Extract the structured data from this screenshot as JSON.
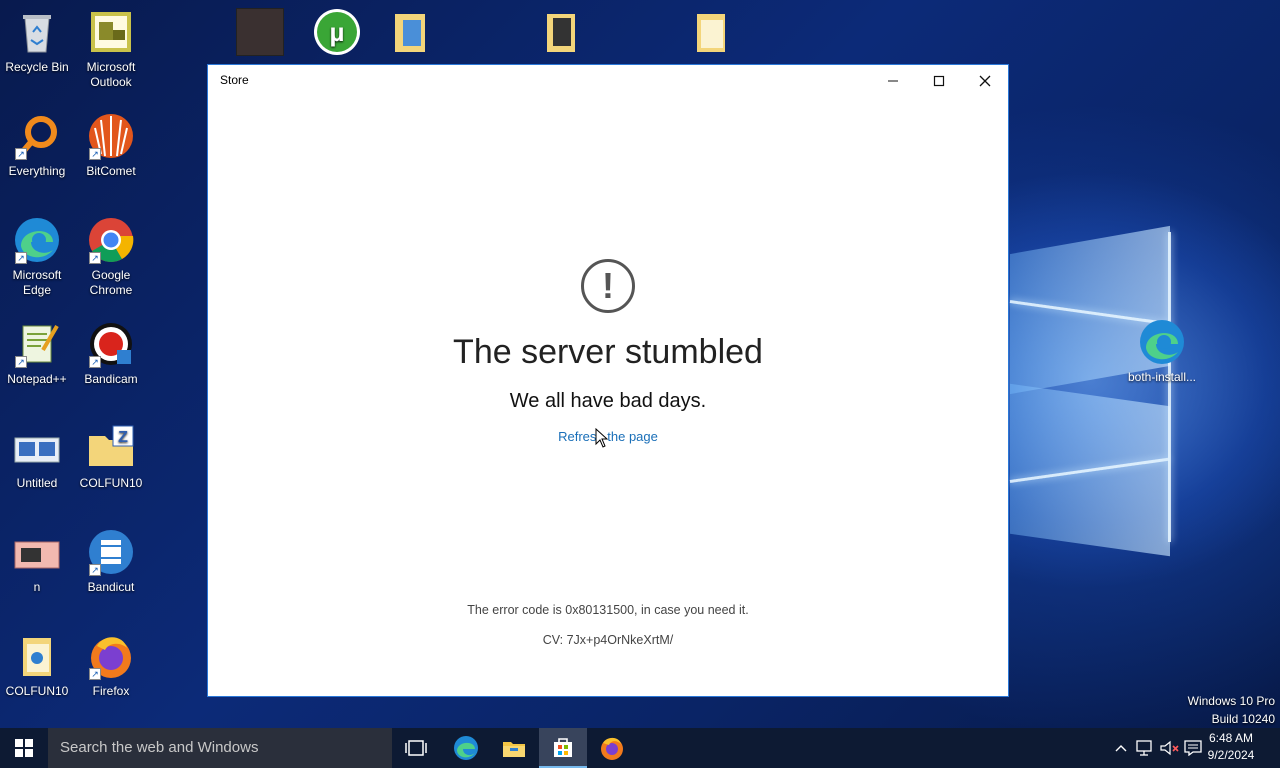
{
  "desktop": {
    "icons_left": [
      {
        "label": "Recycle Bin"
      },
      {
        "label": "Microsoft Outlook"
      },
      {
        "label": "Everything"
      },
      {
        "label": "BitComet"
      },
      {
        "label": "Microsoft Edge"
      },
      {
        "label": "Google Chrome"
      },
      {
        "label": "Notepad++"
      },
      {
        "label": "Bandicam"
      },
      {
        "label": "Untitled"
      },
      {
        "label": "COLFUN10"
      },
      {
        "label": "n"
      },
      {
        "label": "Bandicut"
      },
      {
        "label": "COLFUN10"
      },
      {
        "label": "Firefox"
      }
    ],
    "icon_right": {
      "label": "both-install..."
    },
    "watermark": {
      "line1": "Windows 10 Pro",
      "line2": "Build 10240"
    }
  },
  "store_window": {
    "title": "Store",
    "controls": {
      "minimize": "—",
      "maximize": "☐",
      "close": "✕"
    },
    "error": {
      "glyph": "!",
      "heading": "The server stumbled",
      "subheading": "We all have bad days.",
      "link": "Refresh the page",
      "code_text": "The error code is 0x80131500, in case you need it.",
      "cv_text": "CV: 7Jx+p4OrNkeXrtM/"
    }
  },
  "taskbar": {
    "search_placeholder": "Search the web and Windows",
    "clock": {
      "time": "6:48 AM",
      "date": "9/2/2024"
    },
    "accent_color": "#76b9ed"
  }
}
